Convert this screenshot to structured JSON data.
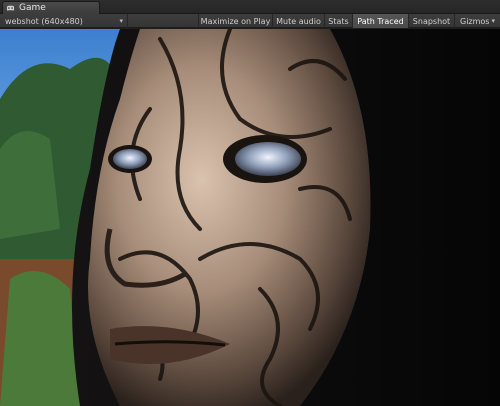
{
  "tab": {
    "label": "Game",
    "icon": "game-controller-icon"
  },
  "toolbar": {
    "resolution": "webshot (640x480)",
    "maximize_on_play": "Maximize on Play",
    "mute_audio": "Mute audio",
    "stats": "Stats",
    "path_traced": "Path Traced",
    "snapshot": "Snapshot",
    "gizmos": "Gizmos"
  },
  "colors": {
    "editor_bg": "#3c3c3c",
    "active_toggle": "#565656",
    "sky": "#4a8ad6"
  }
}
